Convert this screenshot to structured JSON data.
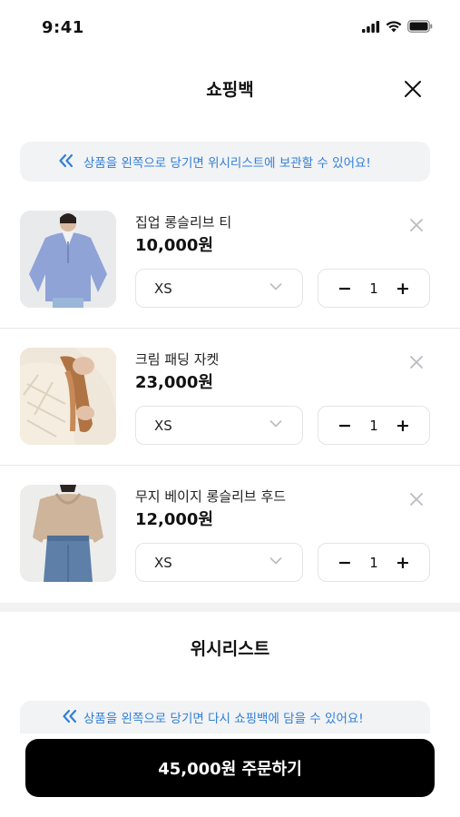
{
  "status": {
    "time": "9:41"
  },
  "header": {
    "title": "쇼핑백"
  },
  "cart": {
    "banner": "상품을 왼쪽으로 당기면 위시리스트에 보관할 수 있어요!",
    "items": [
      {
        "name": "집업 롱슬리브 티",
        "price": "10,000원",
        "size": "XS",
        "quantity": "1"
      },
      {
        "name": "크림 패딩 자켓",
        "price": "23,000원",
        "size": "XS",
        "quantity": "1"
      },
      {
        "name": "무지 베이지 롱슬리브 후드",
        "price": "12,000원",
        "size": "XS",
        "quantity": "1"
      }
    ],
    "minus_label": "−",
    "plus_label": "+"
  },
  "wishlist": {
    "title": "위시리스트",
    "banner": "상품을 왼쪽으로 당기면 다시 쇼핑백에 담을 수 있어요!"
  },
  "order": {
    "label": "45,000원 주문하기"
  },
  "colors": {
    "accent": "#2f7fd8",
    "button": "#000000",
    "banner_bg": "#f2f3f5"
  }
}
